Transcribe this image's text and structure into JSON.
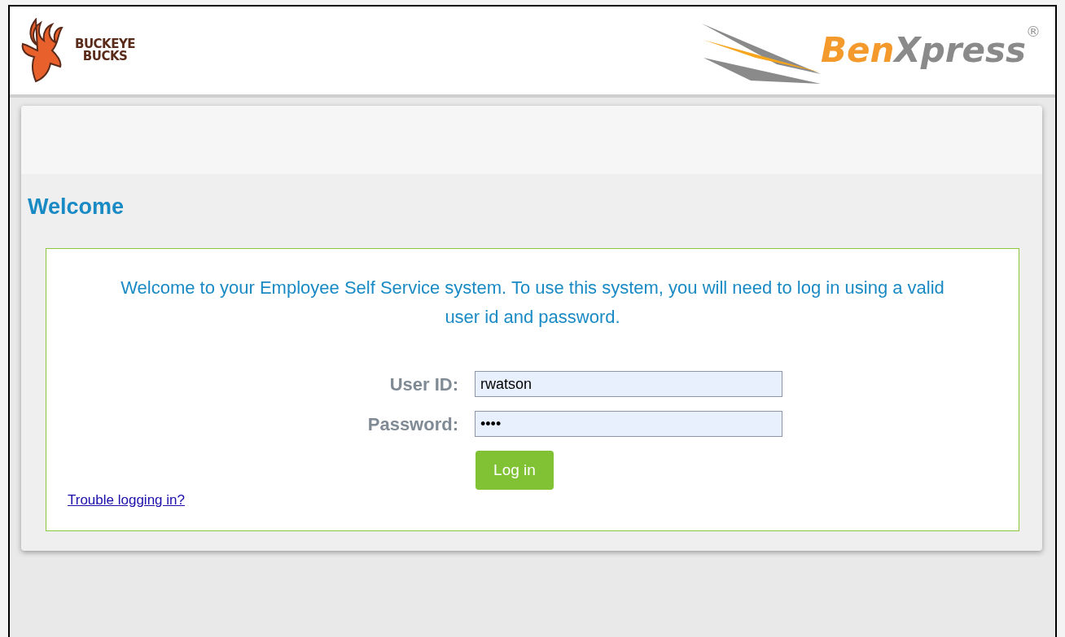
{
  "header": {
    "left_logo": {
      "line_1": "BUCKEYE",
      "line_2": "BUCKS"
    },
    "right_logo": {
      "part_1": "Ben",
      "part_2": "Xpress",
      "mark": "®"
    }
  },
  "page": {
    "title": "Welcome",
    "intro": "Welcome to your Employee Self Service system. To use this system, you will need to log in using a valid user id and password.",
    "fields": [
      {
        "label": "User ID:",
        "value": "rwatson"
      },
      {
        "label": "Password:",
        "value": "••••"
      }
    ],
    "button": "Log in",
    "help_link": "Trouble logging in?"
  }
}
